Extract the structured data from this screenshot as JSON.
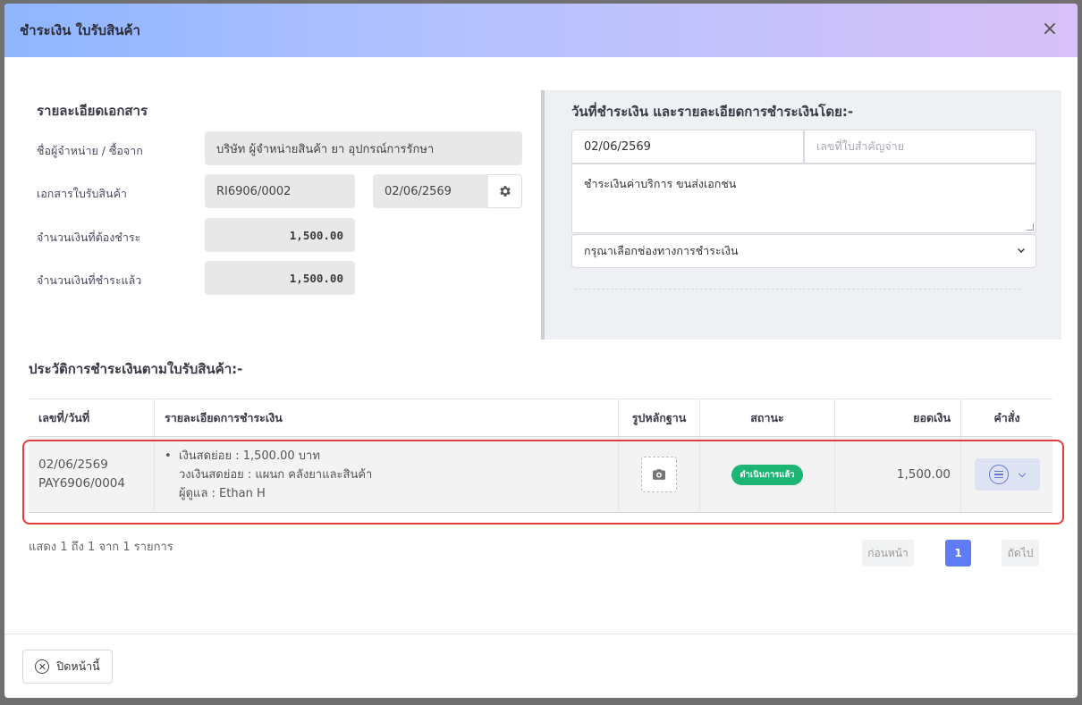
{
  "modal": {
    "title": "ชำระเงิน ใบรับสินค้า",
    "close_icon": "×"
  },
  "doc_details": {
    "title": "รายละเอียดเอกสาร",
    "supplier_label": "ชื่อผู้จำหน่าย / ซื้อจาก",
    "supplier_value": "บริษัท ผู้จำหน่ายสินค้า ยา อุปกรณ์การรักษา",
    "receipt_label": "เอกสารใบรับสินค้า",
    "receipt_no": "RI6906/0002",
    "receipt_date": "02/06/2569",
    "amount_due_label": "จำนวนเงินที่ต้องชำระ",
    "amount_due": "1,500.00",
    "amount_paid_label": "จำนวนเงินที่ชำระแล้ว",
    "amount_paid": "1,500.00"
  },
  "payment_form": {
    "title": "วันที่ชำระเงิน และรายละเอียดการชำระเงินโดย:-",
    "date_value": "02/06/2569",
    "reference_placeholder": "เลขที่ใบสำคัญจ่าย",
    "note_value": "ชำระเงินค่าบริการ ขนส่งเอกชน",
    "channel_placeholder": "กรุณาเลือกช่องทางการชำระเงิน"
  },
  "history": {
    "title": "ประวัติการชำระเงินตามใบรับสินค้า:-",
    "columns": [
      "เลขที่/วันที่",
      "รายละเอียดการชำระเงิน",
      "รูปหลักฐาน",
      "สถานะ",
      "ยอดเงิน",
      "คำสั่ง"
    ],
    "rows": [
      {
        "date": "02/06/2569",
        "number": "PAY6906/0004",
        "detail_line1": "เงินสดย่อย : 1,500.00 บาท",
        "detail_line2": "วงเงินสดย่อย : แผนก คลังยาและสินค้า",
        "detail_line3": "ผู้ดูแล : Ethan H",
        "status": "ดำเนินการแล้ว",
        "amount": "1,500.00"
      }
    ],
    "info": "แสดง 1 ถึง 1 จาก 1 รายการ",
    "prev_label": "ก่อนหน้า",
    "page": "1",
    "next_label": "ถัดไป"
  },
  "footer": {
    "close_label": "ปิดหน้านี้"
  },
  "colors": {
    "status_badge": "#1cb574",
    "pager_active": "#5f7bf5",
    "highlight": "#e23c3c"
  }
}
